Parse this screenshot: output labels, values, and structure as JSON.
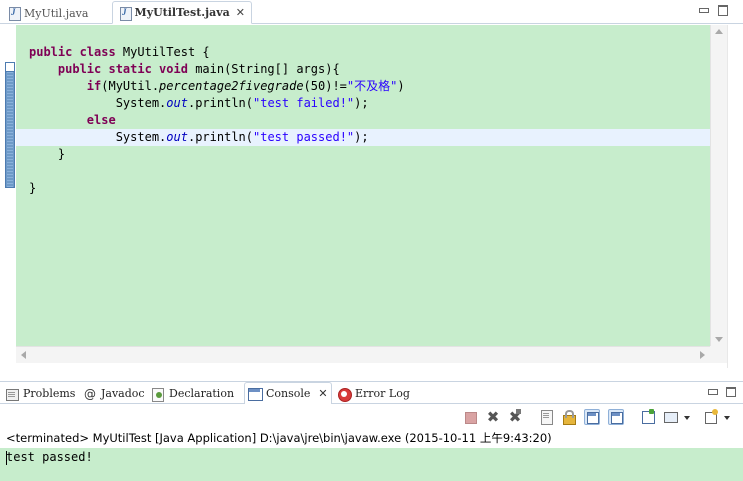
{
  "editor_tabs": [
    {
      "label": "MyUtil.java",
      "active": false
    },
    {
      "label": "MyUtilTest.java",
      "active": true
    }
  ],
  "editor_close_symbol": "✕",
  "code": {
    "line1": {
      "kw": "public class ",
      "rest": "MyUtilTest {"
    },
    "line2": {
      "kw": "public static void ",
      "rest": "main(String[] args){"
    },
    "line3": {
      "kw": "if",
      "a": "(MyUtil.",
      "method": "percentage2fivegrade",
      "b": "(50)!=",
      "str": "\"不及格\"",
      "c": ")"
    },
    "line4": {
      "a": "System.",
      "field": "out",
      "b": ".println(",
      "str": "\"test failed!\"",
      "c": ");"
    },
    "line5": {
      "kw": "else"
    },
    "line6": {
      "a": "System.",
      "field": "out",
      "b": ".println(",
      "str": "\"test passed!\"",
      "c": ");"
    },
    "line7": "}",
    "line8": "}"
  },
  "view_tabs": [
    {
      "label": "Problems",
      "icon": "problems-icon"
    },
    {
      "label": "Javadoc",
      "icon": "javadoc-icon",
      "glyph": "@"
    },
    {
      "label": "Declaration",
      "icon": "declaration-icon"
    },
    {
      "label": "Console",
      "icon": "console-icon",
      "active": true
    },
    {
      "label": "Error Log",
      "icon": "error-log-icon"
    }
  ],
  "view_close_symbol": "✕",
  "console": {
    "description": "<terminated> MyUtilTest [Java Application] D:\\java\\jre\\bin\\javaw.exe (2015-10-11 上午9:43:20)",
    "output": "test passed!"
  },
  "toolbar_glyphs": {
    "remove": "✖",
    "remove_all": "✖"
  },
  "colors": {
    "editor_background": "#c7edcc",
    "keyword": "#7f0055",
    "string": "#2a00ff",
    "field": "#0000c0",
    "current_line": "#e8f2fe"
  }
}
